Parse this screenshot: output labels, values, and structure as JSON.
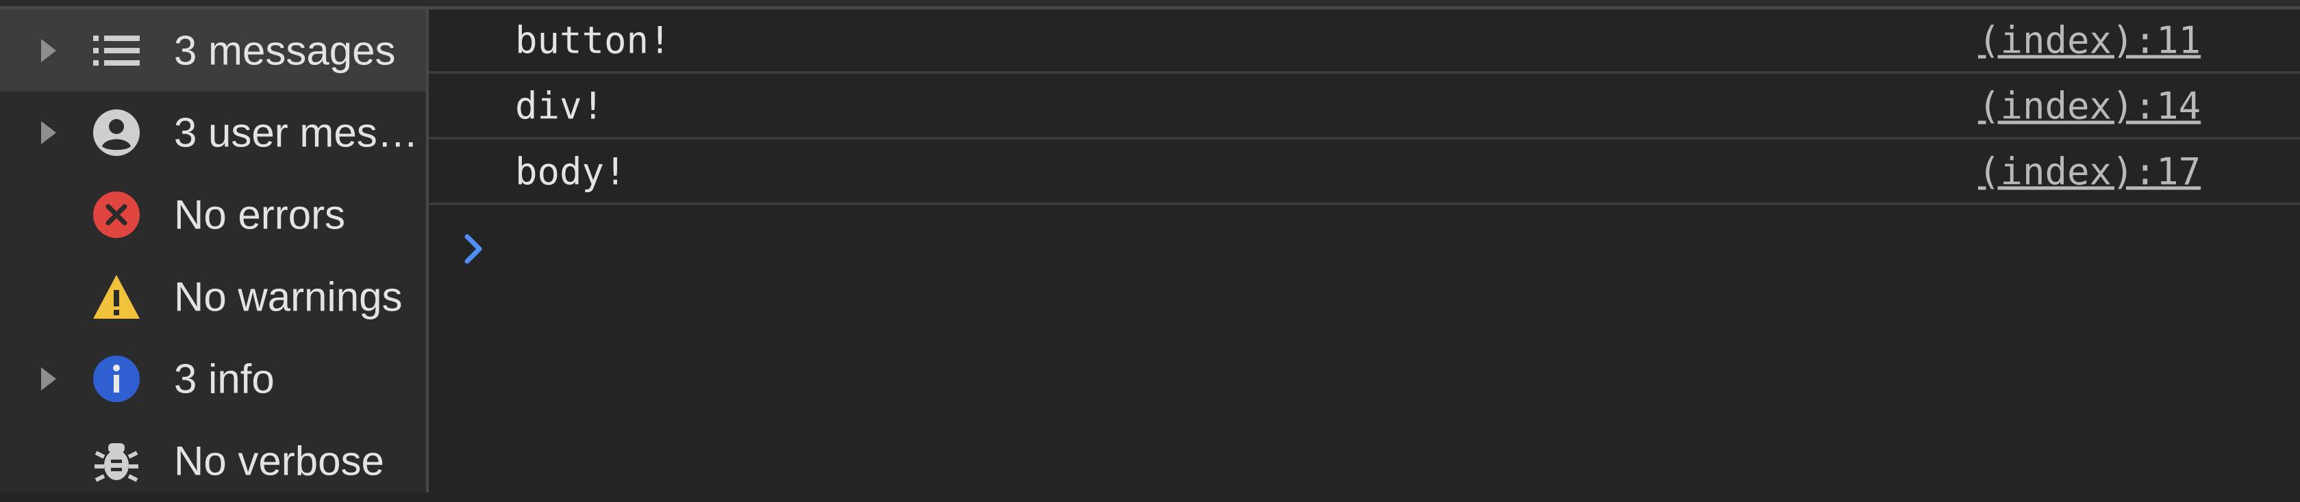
{
  "sidebar": {
    "items": [
      {
        "label": "3 messages",
        "icon": "list-icon",
        "expandable": true,
        "selected": true
      },
      {
        "label": "3 user mes…",
        "icon": "user-icon",
        "expandable": true,
        "selected": false
      },
      {
        "label": "No errors",
        "icon": "error-icon",
        "expandable": false,
        "selected": false
      },
      {
        "label": "No warnings",
        "icon": "warning-icon",
        "expandable": false,
        "selected": false
      },
      {
        "label": "3 info",
        "icon": "info-icon",
        "expandable": true,
        "selected": false
      },
      {
        "label": "No verbose",
        "icon": "bug-icon",
        "expandable": false,
        "selected": false
      }
    ]
  },
  "console": {
    "messages": [
      {
        "text": "button!",
        "source": "(index):11"
      },
      {
        "text": "div!",
        "source": "(index):14"
      },
      {
        "text": "body!",
        "source": "(index):17"
      }
    ],
    "prompt_value": ""
  },
  "colors": {
    "background": "#242424",
    "sidebar": "#2b2b2b",
    "selected": "#3c3c3c",
    "error": "#e0443e",
    "warning": "#f2c23c",
    "info": "#2f5fd0",
    "prompt": "#4f8ff7"
  }
}
